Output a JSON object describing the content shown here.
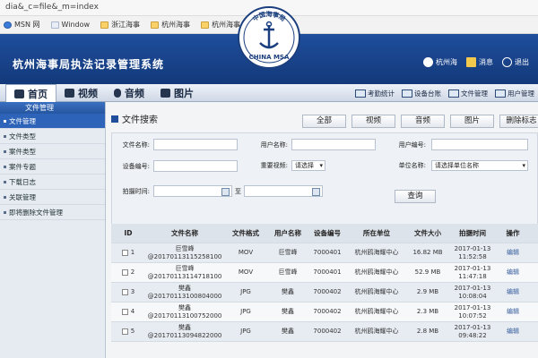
{
  "browser": {
    "address": "dia&_c=file&_m=index",
    "favorites": [
      {
        "label": "MSN 网",
        "icon": "msn-icon"
      },
      {
        "label": "Window",
        "icon": "folder-icon"
      },
      {
        "label": "浙江海事",
        "icon": "page-icon"
      },
      {
        "label": "杭州海事",
        "icon": "page-icon"
      },
      {
        "label": "杭州海事",
        "icon": "page-icon"
      }
    ]
  },
  "header": {
    "title": "杭州海事局执法记录管理系统",
    "emblem_top": "中国海事局",
    "emblem_bottom": "CHINA MSA",
    "user": "杭州海",
    "messages": "消息",
    "logout": "退出"
  },
  "nav": {
    "tabs": [
      {
        "label": "首页",
        "icon": "home-icon"
      },
      {
        "label": "视频",
        "icon": "video-icon"
      },
      {
        "label": "音频",
        "icon": "microphone-icon"
      },
      {
        "label": "图片",
        "icon": "image-icon"
      }
    ],
    "right": [
      {
        "label": "考勤统计",
        "icon": "stats-icon"
      },
      {
        "label": "设备台账",
        "icon": "device-icon"
      },
      {
        "label": "文件管理",
        "icon": "file-icon"
      },
      {
        "label": "用户管理",
        "icon": "user-icon"
      }
    ]
  },
  "sidebar": {
    "header": "文件管理",
    "items": [
      "文件管理",
      "文件类型",
      "案件类型",
      "案件专题",
      "下载日志",
      "关联管理",
      "即将删除文件管理"
    ]
  },
  "search": {
    "title": "文件搜索",
    "filters": [
      "全部",
      "视频",
      "音频",
      "图片",
      "删除标志"
    ],
    "labels": {
      "file_name": "文件名称:",
      "user_name": "用户名称:",
      "user_no": "用户编号:",
      "device_no": "设备编号:",
      "important": "重要视频:",
      "unit": "单位名称:",
      "shot_time": "拍摄时间:",
      "to": "至"
    },
    "important_value": "请选择",
    "unit_value": "请选择单位名称",
    "query": "查询"
  },
  "table": {
    "headers": [
      "ID",
      "文件名称",
      "文件格式",
      "用户名称",
      "设备编号",
      "所在单位",
      "文件大小",
      "拍摄时间",
      "操作"
    ],
    "rows": [
      {
        "id": "1",
        "name1": "巨雪峰",
        "name2": "@20170113115258100",
        "fmt": "MOV",
        "user": "巨雪峰",
        "no": "7000401",
        "unit": "杭州鸥海耀中心",
        "size": "16.82 MB",
        "t1": "2017-01-13",
        "t2": "11:52:58",
        "op": "编辑"
      },
      {
        "id": "2",
        "name1": "巨雪峰",
        "name2": "@20170113114718100",
        "fmt": "MOV",
        "user": "巨雪峰",
        "no": "7000401",
        "unit": "杭州鸥海耀中心",
        "size": "52.9 MB",
        "t1": "2017-01-13",
        "t2": "11:47:18",
        "op": "编辑"
      },
      {
        "id": "3",
        "name1": "樊鑫",
        "name2": "@20170113100804000",
        "fmt": "JPG",
        "user": "樊鑫",
        "no": "7000402",
        "unit": "杭州鸥海耀中心",
        "size": "2.9 MB",
        "t1": "2017-01-13",
        "t2": "10:08:04",
        "op": "编辑"
      },
      {
        "id": "4",
        "name1": "樊鑫",
        "name2": "@20170113100752000",
        "fmt": "JPG",
        "user": "樊鑫",
        "no": "7000402",
        "unit": "杭州鸥海耀中心",
        "size": "2.3 MB",
        "t1": "2017-01-13",
        "t2": "10:07:52",
        "op": "编辑"
      },
      {
        "id": "5",
        "name1": "樊鑫",
        "name2": "@20170113094822000",
        "fmt": "JPG",
        "user": "樊鑫",
        "no": "7000402",
        "unit": "杭州鸥海耀中心",
        "size": "2.8 MB",
        "t1": "2017-01-13",
        "t2": "09:48:22",
        "op": "编辑"
      }
    ]
  },
  "colors": {
    "header": "#1f4e9c",
    "sidebar_active": "#2d63b8"
  }
}
